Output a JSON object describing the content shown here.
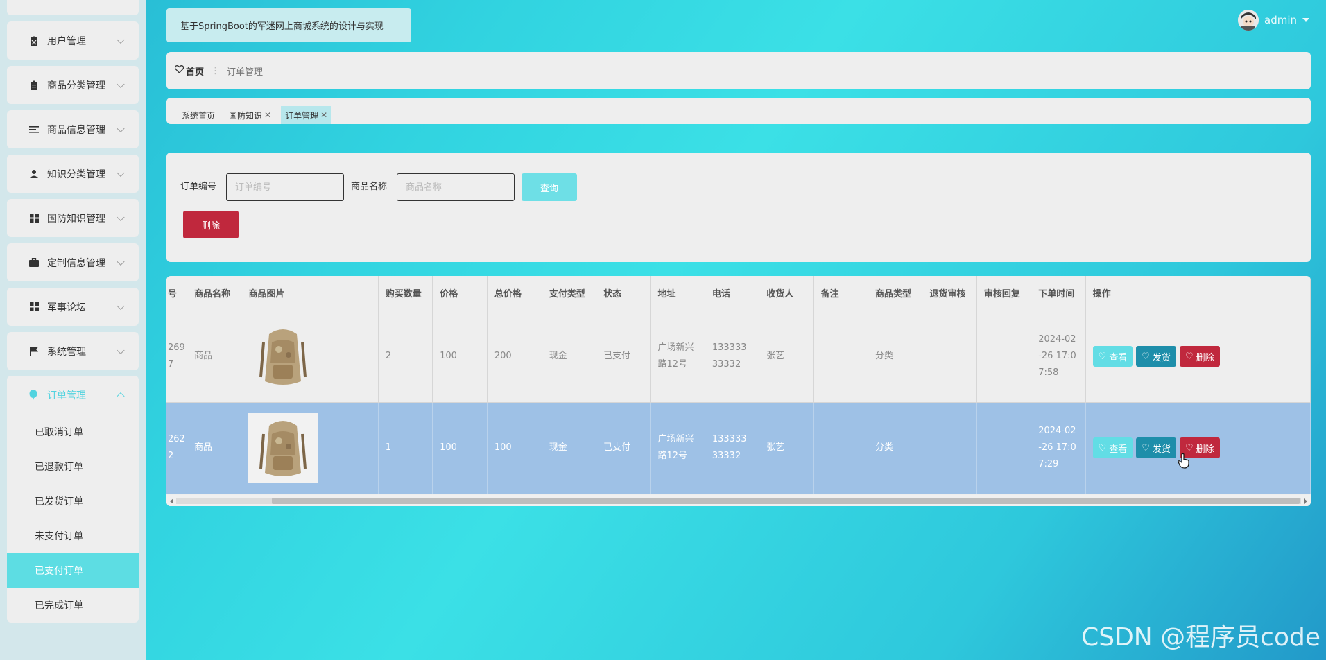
{
  "app": {
    "title": "基于SpringBoot的军迷网上商城系统的设计与实现",
    "user": "admin"
  },
  "sidebar": {
    "items": [
      {
        "label": "用户管理",
        "icon": "clipboard-user-icon"
      },
      {
        "label": "商品分类管理",
        "icon": "clipboard-icon"
      },
      {
        "label": "商品信息管理",
        "icon": "list-icon"
      },
      {
        "label": "知识分类管理",
        "icon": "person-icon"
      },
      {
        "label": "国防知识管理",
        "icon": "grid-icon"
      },
      {
        "label": "定制信息管理",
        "icon": "briefcase-icon"
      },
      {
        "label": "军事论坛",
        "icon": "grid-icon"
      },
      {
        "label": "系统管理",
        "icon": "flag-icon"
      }
    ],
    "open_menu": {
      "label": "订单管理",
      "icon": "balloon-icon",
      "children": [
        "已取消订单",
        "已退款订单",
        "已发货订单",
        "未支付订单",
        "已支付订单",
        "已完成订单"
      ],
      "active": "已支付订单"
    }
  },
  "breadcrumb": {
    "home": "首页",
    "separator": "⋮",
    "current": "订单管理"
  },
  "tabs": [
    {
      "label": "系统首页",
      "closable": false,
      "active": false
    },
    {
      "label": "国防知识",
      "closable": true,
      "active": false
    },
    {
      "label": "订单管理",
      "closable": true,
      "active": true
    }
  ],
  "search": {
    "order_no_label": "订单编号",
    "order_no_placeholder": "订单编号",
    "product_name_label": "商品名称",
    "product_name_placeholder": "商品名称",
    "query_label": "查询",
    "delete_label": "删除"
  },
  "table": {
    "columns": [
      "号",
      "商品名称",
      "商品图片",
      "购买数量",
      "价格",
      "总价格",
      "支付类型",
      "状态",
      "地址",
      "电话",
      "收货人",
      "备注",
      "商品类型",
      "退货审核",
      "审核回复",
      "下单时间",
      "操作"
    ],
    "rows": [
      {
        "no": "2697",
        "name": "商品",
        "qty": "2",
        "price": "100",
        "total": "200",
        "pay": "现金",
        "status": "已支付",
        "address": "广场新兴路12号",
        "phone": "13333333332",
        "receiver": "张艺",
        "remark": "",
        "type": "分类",
        "return_review": "",
        "review_reply": "",
        "time": "2024-02-26 17:07:58"
      },
      {
        "no": "2622",
        "name": "商品",
        "qty": "1",
        "price": "100",
        "total": "100",
        "pay": "现金",
        "status": "已支付",
        "address": "广场新兴路12号",
        "phone": "13333333332",
        "receiver": "张艺",
        "remark": "",
        "type": "分类",
        "return_review": "",
        "review_reply": "",
        "time": "2024-02-26 17:07:29"
      }
    ],
    "actions": {
      "view": "查看",
      "ship": "发货",
      "delete": "删除"
    }
  },
  "watermark": "CSDN @程序员code",
  "colors": {
    "accent": "#52d3df",
    "danger": "#c0283d",
    "ship": "#1e8eaa",
    "selected_row": "#9ec1e6"
  }
}
